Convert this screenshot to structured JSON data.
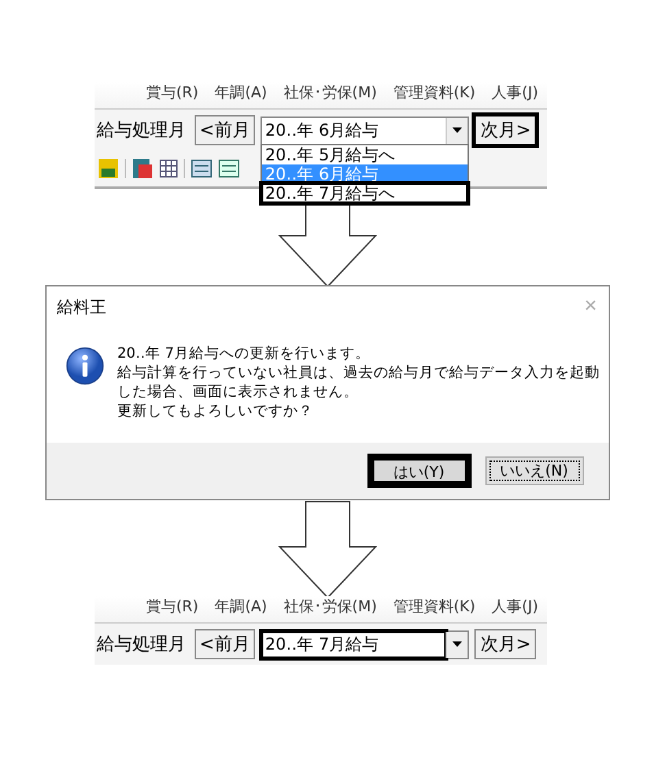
{
  "panels": [
    {
      "menu": [
        "賞与(R)",
        "年調(A)",
        "社保･労保(M)",
        "管理資料(K)",
        "人事(J)"
      ],
      "month_label": "給与処理月",
      "prev_button": {
        "label": "<前月",
        "highlighted": false
      },
      "combo": {
        "value": "20‥年  6月給与",
        "highlighted": false
      },
      "next_button": {
        "label": "次月>",
        "highlighted": true
      },
      "dropdown": [
        {
          "label": "20‥年  5月給与へ",
          "selected": false,
          "highlighted": false
        },
        {
          "label": "20‥年  6月給与",
          "selected": true,
          "highlighted": false
        },
        {
          "label": "20‥年  7月給与へ",
          "selected": false,
          "highlighted": true
        }
      ]
    },
    {
      "menu": [
        "賞与(R)",
        "年調(A)",
        "社保･労保(M)",
        "管理資料(K)",
        "人事(J)"
      ],
      "month_label": "給与処理月",
      "prev_button": {
        "label": "<前月",
        "highlighted": false
      },
      "combo": {
        "value": "20‥年  7月給与",
        "highlighted": true
      },
      "next_button": {
        "label": "次月>",
        "highlighted": false
      }
    }
  ],
  "dialog": {
    "title": "給料王",
    "close": "×",
    "message": [
      "20‥年 7月給与への更新を行います。",
      "給与計算を行っていない社員は、過去の給与月で給与データ入力を起動",
      "した場合、画面に表示されません。",
      "更新してもよろしいですか？"
    ],
    "buttons": [
      {
        "label": "はい(Y)",
        "highlighted": true,
        "focused": false
      },
      {
        "label": "いいえ(N)",
        "highlighted": false,
        "focused": true
      }
    ]
  }
}
